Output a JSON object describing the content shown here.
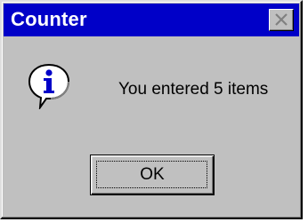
{
  "window": {
    "title": "Counter",
    "close_icon": "close-icon"
  },
  "dialog": {
    "icon": "information-icon",
    "message": "You entered 5 items",
    "ok_label": "OK"
  },
  "colors": {
    "titlebar": "#0000c8",
    "face": "#c0c0c0",
    "title_text": "#ffffff"
  }
}
